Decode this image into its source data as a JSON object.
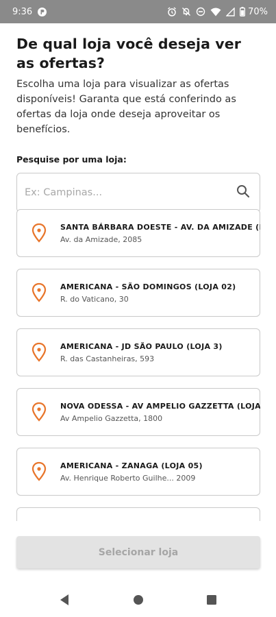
{
  "status_bar": {
    "time": "9:36",
    "battery": "70%",
    "icons": [
      "app-notification-icon",
      "alarm-icon",
      "notifications-off-icon",
      "do-not-disturb-icon",
      "wifi-icon",
      "signal-icon",
      "battery-icon"
    ]
  },
  "header": {
    "title": "De qual loja você deseja ver as ofertas?",
    "subtitle": "Escolha uma loja para visualizar as ofertas disponíveis! Garanta que está conferindo as ofertas da loja onde deseja aproveitar os benefícios."
  },
  "search": {
    "label": "Pesquise por uma loja:",
    "placeholder": "Ex: Campinas...",
    "value": ""
  },
  "stores": [
    {
      "name": "SANTA BÁRBARA DOESTE - AV. DA AMIZADE (L...",
      "address": "Av. da Amizade, 2085"
    },
    {
      "name": "AMERICANA - SÃO DOMINGOS (LOJA 02)",
      "address": "R. do Vaticano, 30"
    },
    {
      "name": "AMERICANA - JD SÃO PAULO (LOJA 3)",
      "address": "R. das Castanheiras, 593"
    },
    {
      "name": "NOVA ODESSA - AV AMPELIO GAZZETTA (LOJA ...",
      "address": "Av Ampelio Gazzetta, 1800"
    },
    {
      "name": "AMERICANA - ZANAGA (LOJA 05)",
      "address": "Av. Henrique Roberto Guilhe... 2009"
    }
  ],
  "select_button": {
    "label": "Selecionar loja"
  },
  "colors": {
    "accent": "#e8762c",
    "status_bar": "#8a8a8a",
    "button_disabled_bg": "#e3e3e3",
    "button_disabled_text": "#a6a6a6"
  }
}
